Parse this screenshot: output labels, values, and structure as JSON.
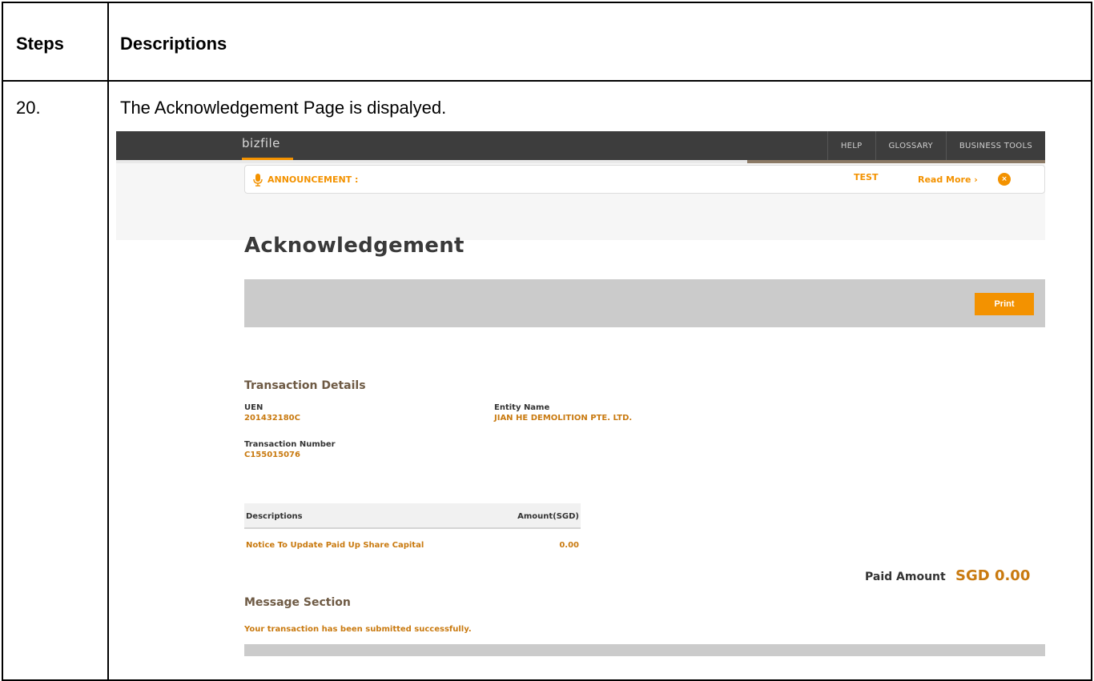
{
  "table": {
    "header_steps": "Steps",
    "header_descriptions": "Descriptions",
    "step_number": "20.",
    "step_text": "The Acknowledgement Page is dispalyed."
  },
  "app": {
    "logo": "bizfile",
    "nav": [
      "HELP",
      "GLOSSARY",
      "BUSINESS TOOLS"
    ],
    "accent_color": "#f39200",
    "header_color": "#3d3d3d"
  },
  "announcement": {
    "label": "ANNOUNCEMENT :",
    "text": "TEST",
    "read_more": "Read More ›",
    "close": "×"
  },
  "page": {
    "title": "Acknowledgement",
    "print_label": "Print"
  },
  "transaction": {
    "section_title": "Transaction Details",
    "uen_label": "UEN",
    "uen_value": "201432180C",
    "entity_label": "Entity Name",
    "entity_value": "JIAN HE DEMOLITION PTE. LTD.",
    "txn_label": "Transaction Number",
    "txn_value": "C155015076"
  },
  "charges": {
    "col_desc": "Descriptions",
    "col_amount": "Amount(SGD)",
    "row_desc": "Notice To Update Paid Up Share Capital",
    "row_amount": "0.00",
    "paid_label": "Paid Amount",
    "paid_value": "SGD 0.00"
  },
  "message": {
    "section_title": "Message Section",
    "text": "Your transaction has been submitted successfully."
  }
}
